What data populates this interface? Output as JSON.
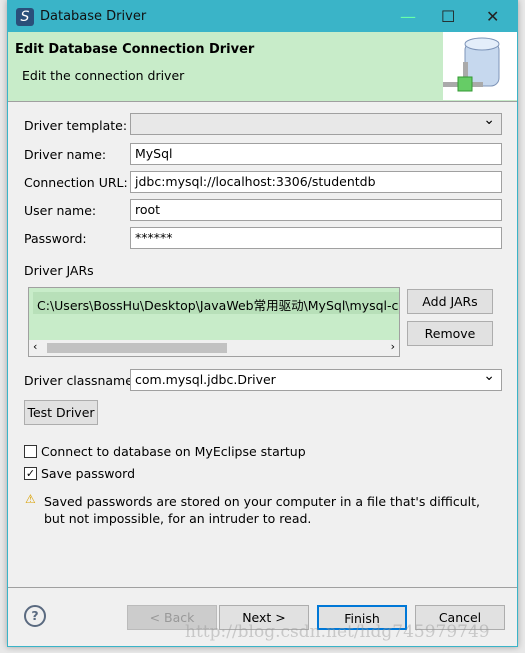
{
  "window": {
    "title": "Database Driver"
  },
  "banner": {
    "title": "Edit Database Connection Driver",
    "subtitle": "Edit the connection driver"
  },
  "form": {
    "template_label": "Driver template:",
    "template_value": "",
    "name_label": "Driver name:",
    "name_value": "MySql",
    "url_label": "Connection URL:",
    "url_value": "jdbc:mysql://localhost:3306/studentdb",
    "user_label": "User name:",
    "user_value": "root",
    "password_label": "Password:",
    "password_value": "******",
    "jars_label": "Driver JARs",
    "jars": [
      "C:\\Users\\BossHu\\Desktop\\JavaWeb常用驱动\\MySql\\mysql-connector"
    ],
    "add_jars": "Add JARs",
    "remove": "Remove",
    "classname_label": "Driver classname:",
    "classname_value": "com.mysql.jdbc.Driver",
    "test_driver": "Test Driver",
    "connect_startup": {
      "label": "Connect to database on MyEclipse startup",
      "checked": false
    },
    "save_password": {
      "label": "Save password",
      "checked": true
    },
    "warning": "Saved passwords are stored on your computer in a file that's difficult, but not impossible, for an intruder to read."
  },
  "footer": {
    "back": "< Back",
    "next": "Next >",
    "finish": "Finish",
    "cancel": "Cancel"
  },
  "watermark": "http://blog.csdn.net/hdg745979749"
}
